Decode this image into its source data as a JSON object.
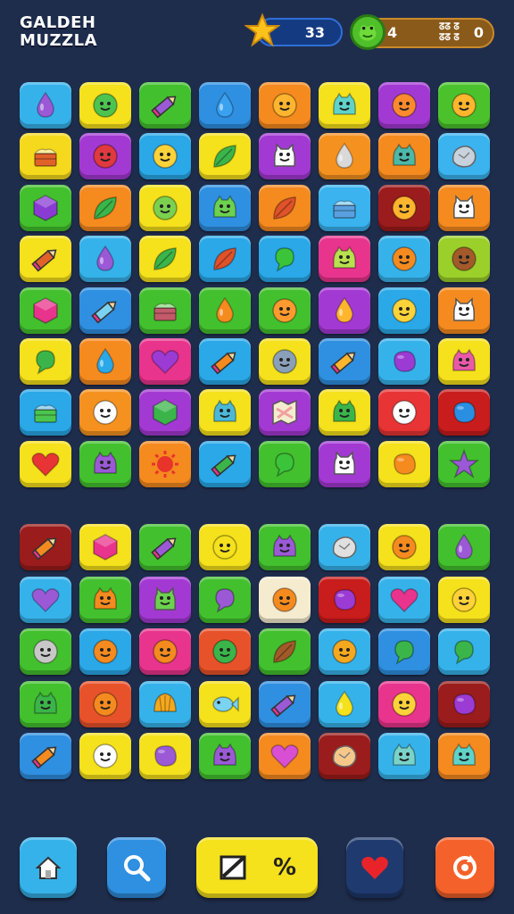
{
  "header": {
    "title_line1": "GALDEH",
    "title_line2": "MUZZLA",
    "score": "33",
    "level": "4",
    "small_label_line1": "ᘔᘔ ᘔ",
    "small_label_line2": "ᘔᘔ ᘔ",
    "coins": "0",
    "icons": [
      "star-icon",
      "frog-coin-icon"
    ]
  },
  "board_top": {
    "rows": [
      [
        [
          "#36b2ea",
          "drop",
          "#9b59d6"
        ],
        [
          "#f5e11c",
          "face",
          "#4cc44f"
        ],
        [
          "#43c02e",
          "pencil",
          "#9b59d6"
        ],
        [
          "#2f8fe0",
          "drop",
          "#3aa1f0"
        ],
        [
          "#f58a1f",
          "face",
          "#ffb52e"
        ],
        [
          "#f5e11c",
          "monster",
          "#5fd3c9"
        ],
        [
          "#a339d3",
          "face",
          "#ff8a2e"
        ],
        [
          "#4bc22b",
          "face",
          "#ffb52e"
        ]
      ],
      [
        [
          "#f5d91c",
          "cake",
          "#e0622a"
        ],
        [
          "#a339d3",
          "face",
          "#e0393f"
        ],
        [
          "#2aa8e8",
          "face",
          "#ffd23a"
        ],
        [
          "#f5e11c",
          "leaf",
          "#3bb54a"
        ],
        [
          "#a339d3",
          "cat",
          "#ffffff"
        ],
        [
          "#f5921f",
          "drop",
          "#d9d9d9"
        ],
        [
          "#f58a1f",
          "monster",
          "#4cb8a8"
        ],
        [
          "#3ab3ef",
          "rock",
          "#c7d2dc"
        ]
      ],
      [
        [
          "#43c02e",
          "gem",
          "#8a3bd3"
        ],
        [
          "#f58a1f",
          "leaf",
          "#3bb54a"
        ],
        [
          "#f5e11c",
          "face",
          "#7bd14f"
        ],
        [
          "#2f8fe0",
          "monster",
          "#6cd14f"
        ],
        [
          "#f58a1f",
          "leaf",
          "#e0522a"
        ],
        [
          "#3ab3ef",
          "cake",
          "#5aa0e0"
        ],
        [
          "#9b1c1c",
          "face",
          "#ffb52e"
        ],
        [
          "#f58a1f",
          "cat",
          "#ffffff"
        ]
      ],
      [
        [
          "#f5e11c",
          "pencil",
          "#e0622a"
        ],
        [
          "#36b2ea",
          "drop",
          "#9b59d6"
        ],
        [
          "#f5e11c",
          "leaf",
          "#3bb54a"
        ],
        [
          "#2aa8e8",
          "leaf",
          "#e0522a"
        ],
        [
          "#2aa8e8",
          "bubble",
          "#3bc43a"
        ],
        [
          "#e8348c",
          "monster",
          "#b8e04f"
        ],
        [
          "#36b2ea",
          "face",
          "#f58a1f"
        ],
        [
          "#9bcf2a",
          "face",
          "#a35a2a"
        ]
      ],
      [
        [
          "#43c02e",
          "gem",
          "#e8348c"
        ],
        [
          "#2f8fe0",
          "pencil",
          "#7ad3f0"
        ],
        [
          "#43c02e",
          "cake",
          "#c25a6a"
        ],
        [
          "#43c02e",
          "drop",
          "#f58a1f"
        ],
        [
          "#43c02e",
          "face",
          "#ff9a2e"
        ],
        [
          "#a339d3",
          "drop",
          "#ffb52e"
        ],
        [
          "#2aa8e8",
          "face",
          "#ffd23a"
        ],
        [
          "#f58a1f",
          "cat",
          "#ffffff"
        ]
      ],
      [
        [
          "#f5e11c",
          "bubble",
          "#3bb54a"
        ],
        [
          "#f58a1f",
          "drop",
          "#2aa8e8"
        ],
        [
          "#e8348c",
          "heart",
          "#9b3bd3"
        ],
        [
          "#2aa8e8",
          "pencil",
          "#f58a1f"
        ],
        [
          "#f5e11c",
          "face",
          "#8aa0b8"
        ],
        [
          "#2f8fe0",
          "pencil",
          "#ffb52e"
        ],
        [
          "#36b2ea",
          "blob",
          "#9b3bd3"
        ],
        [
          "#f5e11c",
          "monster",
          "#e85aa8"
        ]
      ],
      [
        [
          "#2aa8e8",
          "cake",
          "#4cc44f"
        ],
        [
          "#f5921f",
          "face",
          "#ffffff"
        ],
        [
          "#a339d3",
          "gem",
          "#3bb54a"
        ],
        [
          "#f5e11c",
          "monster",
          "#4cb8d8"
        ],
        [
          "#a339d3",
          "map",
          "#f0a0a0"
        ],
        [
          "#f5e11c",
          "monster",
          "#3bb54a"
        ],
        [
          "#e83434",
          "face",
          "#ffffff"
        ],
        [
          "#c91c1c",
          "blob",
          "#2a8fe0"
        ]
      ],
      [
        [
          "#f5e11c",
          "heart",
          "#e83434"
        ],
        [
          "#43c02e",
          "monster",
          "#9b59d6"
        ],
        [
          "#f58a1f",
          "sun",
          "#e8342a"
        ],
        [
          "#2aa8e8",
          "pencil",
          "#3bb54a"
        ],
        [
          "#43c02e",
          "bubble",
          "#3bc43a"
        ],
        [
          "#a339d3",
          "cat",
          "#ffffff"
        ],
        [
          "#f5e11c",
          "blob",
          "#f58a1f"
        ],
        [
          "#43c02e",
          "star",
          "#9b59d6"
        ]
      ]
    ]
  },
  "board_bottom": {
    "rows": [
      [
        [
          "#9b1c1c",
          "pencil",
          "#f58a1f"
        ],
        [
          "#f5e11c",
          "gem",
          "#e8348c"
        ],
        [
          "#43c02e",
          "pencil",
          "#9b59d6"
        ],
        [
          "#f5e11c",
          "face",
          "#f5e11c"
        ],
        [
          "#43c02e",
          "monster",
          "#9b59d6"
        ],
        [
          "#36b2ea",
          "rock",
          "#e0e0e0"
        ],
        [
          "#f5e11c",
          "face",
          "#f58a1f"
        ],
        [
          "#43c02e",
          "drop",
          "#9b59d6"
        ]
      ],
      [
        [
          "#36b2ea",
          "heart",
          "#9b59d6"
        ],
        [
          "#43c02e",
          "monster",
          "#f58a1f"
        ],
        [
          "#a339d3",
          "cat",
          "#6cd14f"
        ],
        [
          "#43c02e",
          "bubble",
          "#9b59d6"
        ],
        [
          "#f5ecd0",
          "face",
          "#f58a1f"
        ],
        [
          "#c91c1c",
          "blob",
          "#9b3bd3"
        ],
        [
          "#36b2ea",
          "heart",
          "#e8348c"
        ],
        [
          "#f5e11c",
          "face",
          "#ffd23a"
        ]
      ],
      [
        [
          "#43c02e",
          "face",
          "#c8c8c8"
        ],
        [
          "#2aa8e8",
          "face",
          "#f58a1f"
        ],
        [
          "#e8348c",
          "face",
          "#f58a1f"
        ],
        [
          "#e8522a",
          "face",
          "#3bb54a"
        ],
        [
          "#43c02e",
          "leaf",
          "#a35a2a"
        ],
        [
          "#36b2ea",
          "face",
          "#f5a81f"
        ],
        [
          "#2f8fe0",
          "bubble",
          "#3bb54a"
        ],
        [
          "#36b2ea",
          "bubble",
          "#3bb54a"
        ]
      ],
      [
        [
          "#43c02e",
          "monster",
          "#3bb54a"
        ],
        [
          "#e8522a",
          "face",
          "#f58a1f"
        ],
        [
          "#36b2ea",
          "shell",
          "#f5a81f"
        ],
        [
          "#f5e11c",
          "fish",
          "#7ad3f0"
        ],
        [
          "#2f8fe0",
          "pencil",
          "#9b59d6"
        ],
        [
          "#36b2ea",
          "drop",
          "#f5e11c"
        ],
        [
          "#e8348c",
          "face",
          "#ffd23a"
        ],
        [
          "#9b1c1c",
          "blob",
          "#9b3bd3"
        ]
      ],
      [
        [
          "#2f8fe0",
          "pencil",
          "#f58a1f"
        ],
        [
          "#f5e11c",
          "face",
          "#ffffff"
        ],
        [
          "#f5e11c",
          "blob",
          "#9b59d6"
        ],
        [
          "#43c02e",
          "monster",
          "#9b59d6"
        ],
        [
          "#f58a1f",
          "heart",
          "#d94fd3"
        ],
        [
          "#9b1c1c",
          "rock",
          "#f5c88a"
        ],
        [
          "#36b2ea",
          "monster",
          "#7ad3c8"
        ],
        [
          "#f58a1f",
          "monster",
          "#5fd3c9"
        ]
      ]
    ]
  },
  "toolbar": {
    "buttons": [
      {
        "name": "home-button",
        "icon": "home-icon",
        "color": "#36b2ea"
      },
      {
        "name": "search-button",
        "icon": "magnifier-icon",
        "color": "#2f8fe0"
      },
      {
        "name": "shuffle-button",
        "icon": "slash-icon",
        "color": "#f5e11c",
        "text": "%"
      },
      {
        "name": "lives-button",
        "icon": "heart-icon",
        "color": "#1f3a6e"
      },
      {
        "name": "restart-button",
        "icon": "restart-icon",
        "color": "#f5612a"
      }
    ]
  }
}
